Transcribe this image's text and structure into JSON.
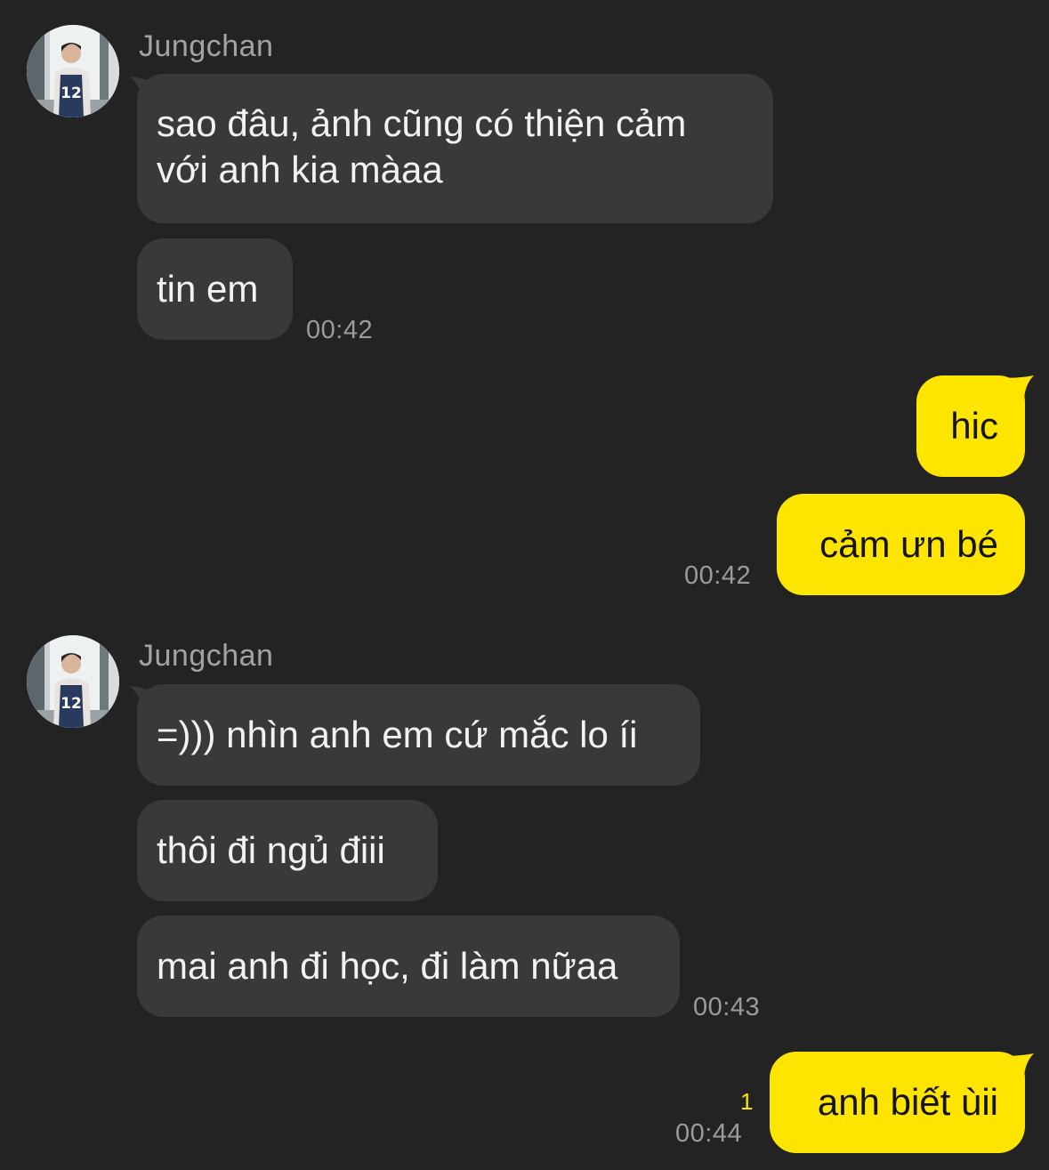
{
  "colors": {
    "background": "#232324",
    "incoming_bubble": "#39393c",
    "outgoing_bubble": "#fee500",
    "unread_count": "#fee500"
  },
  "groups": [
    {
      "sender": "Jungchan",
      "avatar": "profile-photo",
      "messages": [
        "sao đâu, ảnh cũng có thiện cảm\nvới anh kia màaa",
        "tin em"
      ],
      "time": "00:42"
    },
    {
      "outgoing": true,
      "messages": [
        "hic",
        "cảm ưn bé"
      ],
      "time": "00:42"
    },
    {
      "sender": "Jungchan",
      "avatar": "profile-photo",
      "messages": [
        "=))) nhìn anh em cứ mắc lo íi",
        "thôi đi ngủ điii",
        "mai anh đi học, đi làm nữaa"
      ],
      "time": "00:43"
    },
    {
      "outgoing": true,
      "messages": [
        "anh biết ùii"
      ],
      "time": "00:44",
      "unread": "1"
    }
  ]
}
